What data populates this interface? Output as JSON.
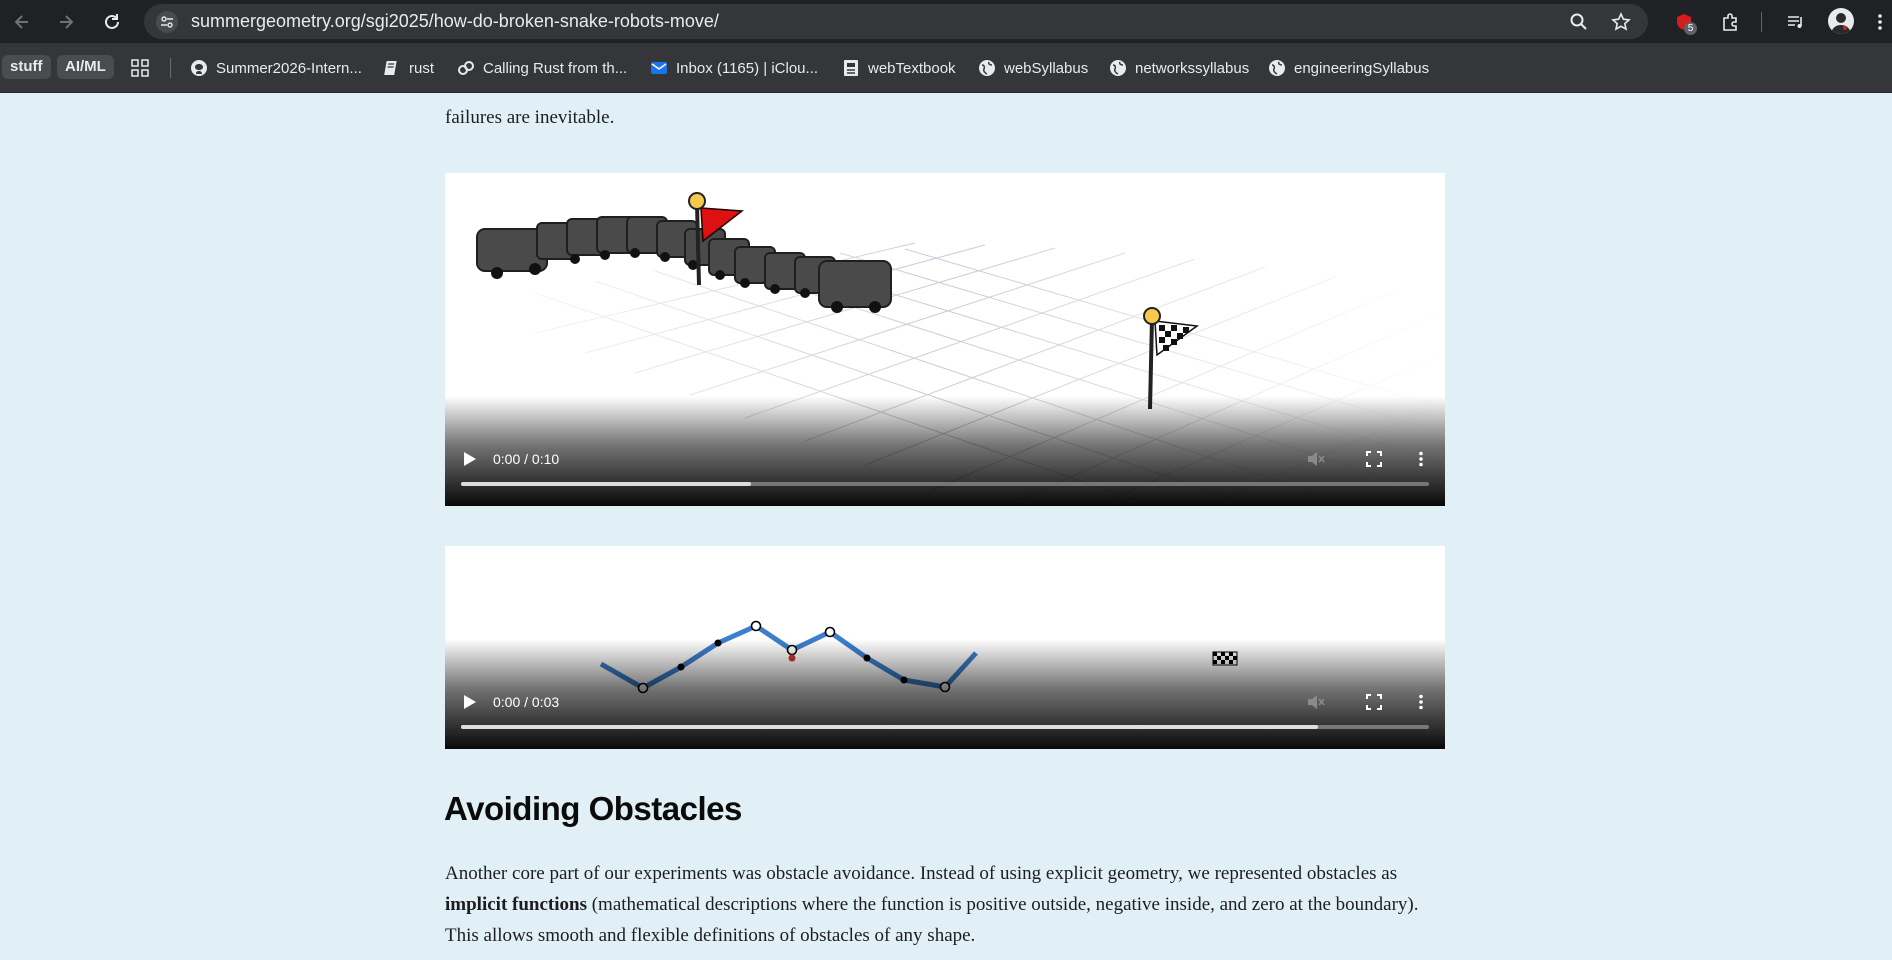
{
  "browser": {
    "url": "summergeometry.org/sgi2025/how-do-broken-snake-robots-move/",
    "extension_badge": "5",
    "bookmarks": [
      {
        "label": "stuff",
        "icon": "folder-chip"
      },
      {
        "label": "AI/ML",
        "icon": "folder-chip"
      },
      {
        "label": "Summer2026-Intern...",
        "icon": "github-icon"
      },
      {
        "label": "rust",
        "icon": "book-icon"
      },
      {
        "label": "Calling Rust from th...",
        "icon": "link-icon"
      },
      {
        "label": "Inbox (1165) | iClou...",
        "icon": "mail-icon"
      },
      {
        "label": "webTextbook",
        "icon": "doc-icon"
      },
      {
        "label": "webSyllabus",
        "icon": "globe-icon"
      },
      {
        "label": "networkssyllabus",
        "icon": "globe-icon"
      },
      {
        "label": "engineeringSyllabus",
        "icon": "globe-icon"
      }
    ]
  },
  "article": {
    "intro_tail": "failures are inevitable.",
    "video1": {
      "time": "0:00 / 0:10",
      "progress": 0.3
    },
    "video2": {
      "time": "0:00 / 0:03",
      "progress": 0.885
    },
    "heading": "Avoiding Obstacles",
    "para": {
      "part1": "Another core part of our experiments was obstacle avoidance. Instead of using explicit geometry, we represented obstacles as ",
      "bold": "implicit functions",
      "part2": " (mathematical descriptions where the function is positive outside, negative inside, and zero at the boundary). This allows smooth and flexible definitions of obstacles of any shape."
    }
  },
  "colors": {
    "page_bg": "#e1eff6",
    "chrome_bg": "#202124",
    "omnibox_bg": "#35363a",
    "snake_line": "#3d7fcb",
    "flag_red": "#dd1111"
  }
}
